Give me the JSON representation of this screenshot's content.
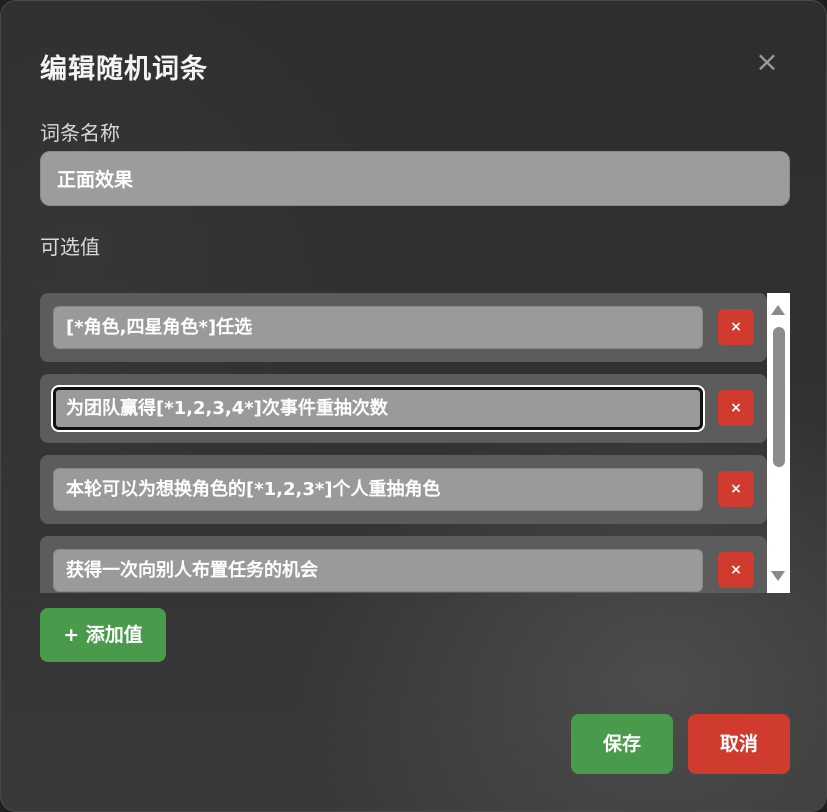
{
  "dialog": {
    "title": "编辑随机词条",
    "close_symbol": "×"
  },
  "name_field": {
    "label": "词条名称",
    "value": "正面效果"
  },
  "values_section": {
    "label": "可选值",
    "items": [
      {
        "value": "[*角色,四星角色*]任选",
        "remove_symbol": "×"
      },
      {
        "value": "为团队赢得[*1,2,3,4*]次事件重抽次数",
        "remove_symbol": "×"
      },
      {
        "value": "本轮可以为想换角色的[*1,2,3*]个人重抽角色",
        "remove_symbol": "×"
      },
      {
        "value": "获得一次向别人布置任务的机会",
        "remove_symbol": "×"
      }
    ],
    "add_label": "+ 添加值"
  },
  "footer": {
    "save_label": "保存",
    "cancel_label": "取消"
  },
  "colors": {
    "accent_green": "#4a9a4c",
    "danger_red": "#d03b30"
  }
}
